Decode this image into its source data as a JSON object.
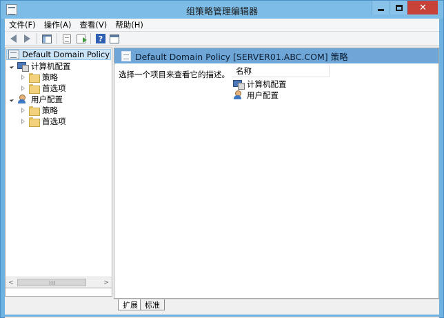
{
  "window": {
    "title": "组策略管理编辑器",
    "min_label": "",
    "max_label": "",
    "close_label": "✕"
  },
  "menu": {
    "items": [
      "文件(F)",
      "操作(A)",
      "查看(V)",
      "帮助(H)"
    ]
  },
  "toolbar": {
    "buttons": [
      "back-icon",
      "forward-icon",
      "show-hide-tree-icon",
      "properties-icon",
      "export-list-icon",
      "help-icon",
      "console-view-icon"
    ],
    "help_glyph": "?"
  },
  "tree": {
    "root": "Default Domain Policy [SERVER01.ABC.COM] 策略",
    "computer_config": "计算机配置",
    "computer_children": [
      "策略",
      "首选项"
    ],
    "user_config": "用户配置",
    "user_children": [
      "策略",
      "首选项"
    ],
    "scroll_grip": "III",
    "scroll_left": "<",
    "scroll_right": ">"
  },
  "details": {
    "title": "Default Domain Policy [SERVER01.ABC.COM] 策略",
    "description": "选择一个项目来查看它的描述。",
    "column_name": "名称",
    "items": [
      "计算机配置",
      "用户配置"
    ]
  },
  "tabs": [
    "扩展",
    "标准"
  ]
}
